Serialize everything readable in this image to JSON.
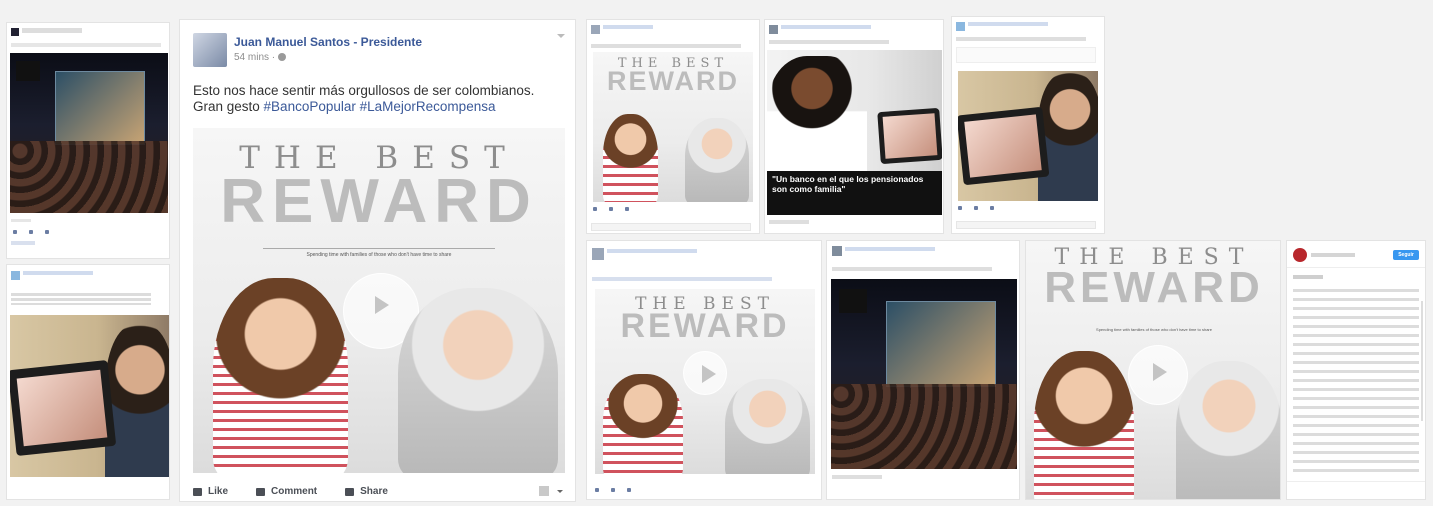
{
  "common": {
    "like": "Like",
    "comment": "Comment",
    "share": "Share"
  },
  "main_post": {
    "author": "Juan Manuel Santos - Presidente",
    "time": "54 mins · ",
    "text_line1": "Esto nos hace sentir más orgullosos de ser colombianos.",
    "text_prefix": "Gran gesto ",
    "hashtag1": "#BancoPopular",
    "hashtag2": "#LaMejorRecompensa"
  },
  "reward_ad": {
    "the_best": "THE BEST",
    "reward": "REWARD",
    "tagline": "Spending time with families of those who don't have time to share"
  },
  "nurse_caption": "\"Un banco en el que los pensionados son como familia\"",
  "instagram": {
    "follow_button": "Seguir"
  },
  "colors": {
    "fb_blue": "#3b5998",
    "ig_blue": "#3897f0",
    "caption_bg": "#111111"
  },
  "icons": [
    "like-icon",
    "comment-icon",
    "share-icon",
    "play-icon",
    "chevron-down-icon",
    "avatar"
  ]
}
